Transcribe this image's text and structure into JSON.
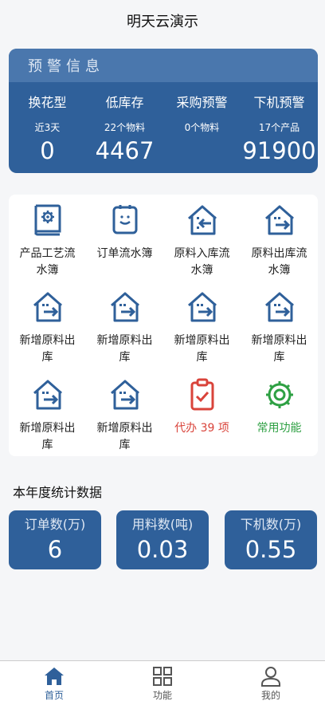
{
  "header": {
    "title": "明天云演示"
  },
  "alert": {
    "title": "预警信息",
    "columns": [
      {
        "label": "换花型",
        "sub": "近3天",
        "value": "0"
      },
      {
        "label": "低库存",
        "sub": "22个物料",
        "value": "4467"
      },
      {
        "label": "采购预警",
        "sub": "0个物料",
        "value": ""
      },
      {
        "label": "下机预警",
        "sub": "17个产品",
        "value": "91900"
      }
    ]
  },
  "grid": {
    "items": [
      {
        "label": "产品工艺流水簿",
        "icon": "gear-book-icon"
      },
      {
        "label": "订单流水簿",
        "icon": "tablet-face-icon"
      },
      {
        "label": "原料入库流水簿",
        "icon": "warehouse-in-icon"
      },
      {
        "label": "原料出库流水簿",
        "icon": "warehouse-out-icon"
      },
      {
        "label": "新增原料出库",
        "icon": "warehouse-out-icon"
      },
      {
        "label": "新增原料出库",
        "icon": "warehouse-out-icon"
      },
      {
        "label": "新增原料出库",
        "icon": "warehouse-out-icon"
      },
      {
        "label": "新增原料出库",
        "icon": "warehouse-out-icon"
      },
      {
        "label": "新增原料出库",
        "icon": "warehouse-out-icon"
      },
      {
        "label": "新增原料出库",
        "icon": "warehouse-out-icon"
      },
      {
        "label": "代办 39 项",
        "icon": "clipboard-check-icon"
      },
      {
        "label": "常用功能",
        "icon": "gear-icon"
      }
    ]
  },
  "stats": {
    "title": "本年度统计数据",
    "items": [
      {
        "label": "订单数(万)",
        "value": "6"
      },
      {
        "label": "用料数(吨)",
        "value": "0.03"
      },
      {
        "label": "下机数(万)",
        "value": "0.55"
      }
    ]
  },
  "tabbar": {
    "tabs": [
      {
        "label": "首页",
        "icon": "home-icon"
      },
      {
        "label": "功能",
        "icon": "grid-icon"
      },
      {
        "label": "我的",
        "icon": "user-icon"
      }
    ]
  },
  "colors": {
    "primary": "#2f609a",
    "header_band": "#4a77ad",
    "alert_red": "#d9433a",
    "success_green": "#2ea043"
  }
}
